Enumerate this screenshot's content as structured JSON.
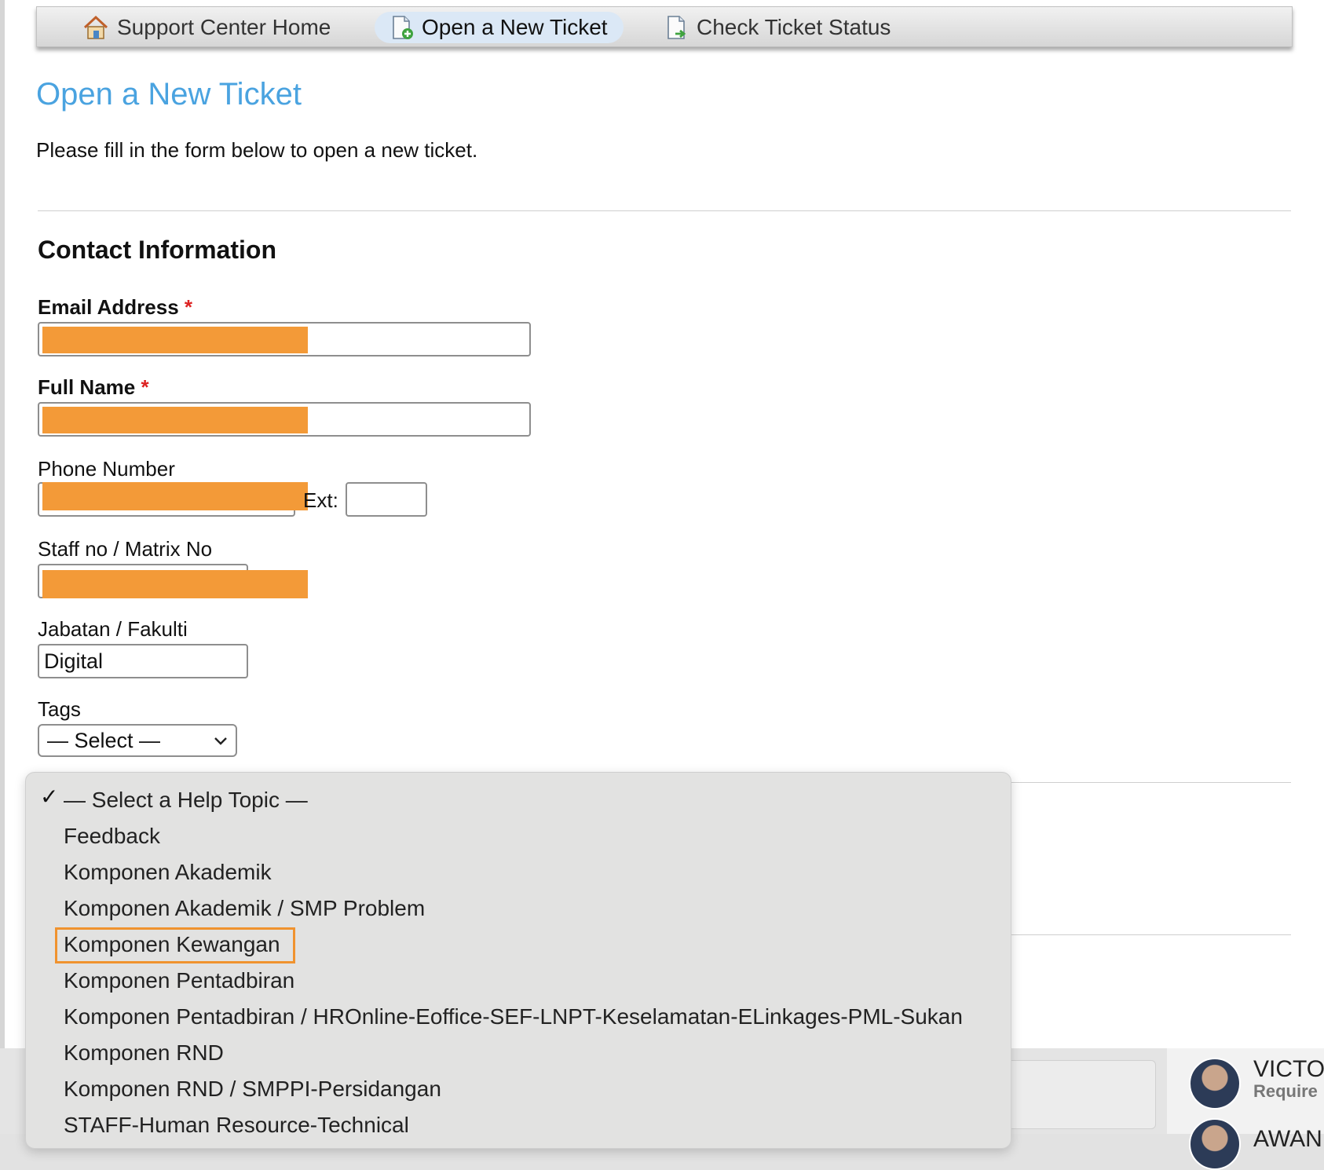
{
  "nav": {
    "items": [
      {
        "label": "Support Center Home",
        "icon": "home-icon"
      },
      {
        "label": "Open a New Ticket",
        "icon": "new-ticket-icon",
        "active": true
      },
      {
        "label": "Check Ticket Status",
        "icon": "ticket-status-icon"
      }
    ]
  },
  "page": {
    "title": "Open a New Ticket",
    "intro": "Please fill in the form below to open a new ticket."
  },
  "contact": {
    "section_title": "Contact Information",
    "email_label": "Email Address",
    "required_mark": "*",
    "full_name_label": "Full Name",
    "phone_label": "Phone Number",
    "ext_label": "Ext:",
    "ext_value": "",
    "staff_label": "Staff no / Matrix No",
    "jabatan_label": "Jabatan / Fakulti",
    "jabatan_value": "Digital",
    "tags_label": "Tags",
    "tags_selected": "— Select —"
  },
  "help_topic": {
    "check_mark": "✓",
    "options": [
      "— Select a Help Topic —",
      "Feedback",
      "Komponen Akademik",
      "Komponen Akademik / SMP Problem",
      "Komponen Kewangan",
      "Komponen Pentadbiran",
      "Komponen Pentadbiran / HROnline-Eoffice-SEF-LNPT-Keselamatan-ELinkages-PML-Sukan",
      "Komponen RND",
      "Komponen RND / SMPPI-Persidangan",
      "STAFF-Human Resource-Technical"
    ],
    "selected_index": 0,
    "highlighted_index": 4
  },
  "background": {
    "person_1_name": "VICTO",
    "person_1_sub": "Require",
    "person_2_name": "AWAN"
  },
  "colors": {
    "title": "#4aa3e0",
    "redaction": "#f39a38",
    "highlight_border": "#f0932f",
    "required": "#dd2222"
  }
}
